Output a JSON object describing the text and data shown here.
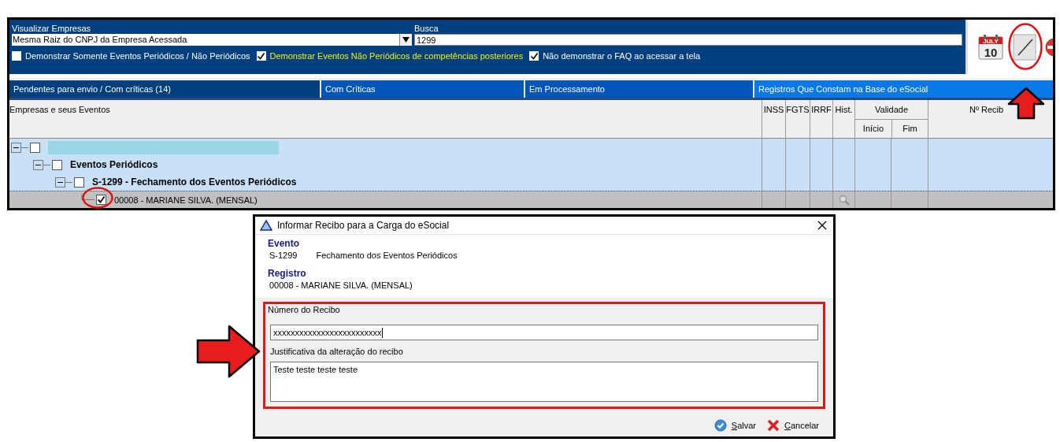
{
  "filter": {
    "company_label": "Visualizar Empresas",
    "company_value": "Mesma Raiz do CNPJ da Empresa Acessada",
    "search_label": "Busca",
    "search_value": "1299"
  },
  "options": [
    {
      "label": "Demonstrar Somente Eventos Periódicos / Não Periódicos",
      "checked": false,
      "highlighted": false
    },
    {
      "label": "Demonstrar Eventos Não Periódicos de competências posteriores",
      "checked": true,
      "highlighted": true
    },
    {
      "label": "Não demonstrar o FAQ ao acessar a tela",
      "checked": true,
      "highlighted": false
    }
  ],
  "toolbar": {
    "calendar_month": "JULY",
    "calendar_day": "10"
  },
  "tabs": [
    {
      "label": "Pendentes para envio / Com críticas (14)",
      "selected": true
    },
    {
      "label": "Com Críticas",
      "selected": false
    },
    {
      "label": "Em Processamento",
      "selected": false
    },
    {
      "label": "Registros Que Constam na Base do eSocial",
      "selected": false
    }
  ],
  "table": {
    "tree_header": "Empresas e seus Eventos",
    "columns": [
      "INSS",
      "FGTS",
      "IRRF",
      "Hist."
    ],
    "validity_header": "Validade",
    "validity_columns": [
      "Início",
      "Fim"
    ],
    "receipt_header": "Nº Recib"
  },
  "tree": [
    {
      "kind": "redacted",
      "expanded": true,
      "checked": false,
      "selected": false,
      "children": [
        {
          "kind": "group",
          "label": "Eventos Periódicos",
          "expanded": true,
          "checked": false,
          "selected": false,
          "children": [
            {
              "kind": "group",
              "label": "S-1299 - Fechamento dos Eventos Periódicos",
              "expanded": true,
              "checked": false,
              "selected": false,
              "children": [
                {
                  "kind": "item",
                  "label": "00008 - MARIANE SILVA. (MENSAL)",
                  "checked": true,
                  "selected": true,
                  "history": true
                }
              ]
            }
          ]
        }
      ]
    }
  ],
  "dialog": {
    "title": "Informar Recibo para a Carga do eSocial",
    "event_label": "Evento",
    "event_code": "S-1299",
    "event_name": "Fechamento dos Eventos Periódicos",
    "record_label": "Registro",
    "record_value": "00008 - MARIANE SILVA. (MENSAL)",
    "group_label": "Número do Recibo",
    "receipt_value": "xxxxxxxxxxxxxxxxxxxxxxxxx",
    "justification_label": "Justificativa da alteração do recibo",
    "justification_value": "Teste teste teste teste",
    "buttons": [
      {
        "kind": "save",
        "label": "Salvar"
      },
      {
        "kind": "cancel",
        "label": "Cancelar"
      }
    ]
  }
}
